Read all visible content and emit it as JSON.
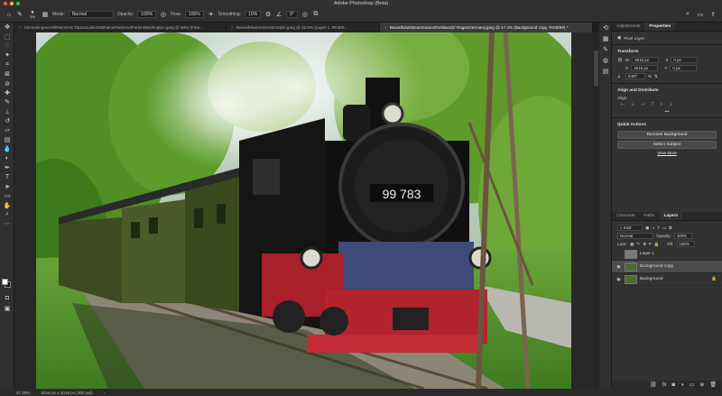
{
  "window": {
    "title": "Adobe Photoshop (Beta)"
  },
  "options": {
    "brush_size": "300",
    "mode_label": "Mode:",
    "mode_value": "Normal",
    "opacity_label": "Opacity:",
    "opacity_value": "100%",
    "flow_label": "Flow:",
    "flow_value": "100%",
    "smoothing_label": "Smoothing:",
    "smoothing_value": "10%",
    "angle_value": "0°"
  },
  "tabs": [
    {
      "label": "SunsettingoverMtRainierat TipsooLakeinMtRainierNationalParkinWashington.jpeg @ 50% (Fore...",
      "active": false
    },
    {
      "label": "Beautifulwomaninretrostyle.jpeg @ 32.8% (Layer 1, RGB/8...",
      "active": false
    },
    {
      "label": "Beautifuloldsteamtrainonthelslandof RügenGermany.jpeg @ 47.4% (Background copy, RGB/8#) *",
      "active": true
    }
  ],
  "photo": {
    "plate": "99 783"
  },
  "status": {
    "zoom": "47.38%",
    "doc_size": "6016 px x 4016 px (300 ppi)"
  },
  "properties": {
    "tabs": [
      "Adjustments",
      "Properties"
    ],
    "layer_type": "Pixel Layer",
    "transform_title": "Transform",
    "w_label": "W",
    "w_value": "6016 px",
    "h_label": "H",
    "h_value": "4016 px",
    "x_label": "X",
    "x_value": "0 px",
    "y_label": "Y",
    "y_value": "0 px",
    "angle": "0.00°",
    "align_title": "Align and Distribute",
    "align_label": "Align:",
    "quick_actions_title": "Quick Actions",
    "remove_bg": "Remove Background",
    "select_subject": "Select Subject",
    "view_more": "View More"
  },
  "layers_panel": {
    "tabs": [
      "Channels",
      "Paths",
      "Layers"
    ],
    "kind": "Kind",
    "blend": "Normal",
    "opacity_label": "Opacity:",
    "opacity_value": "100%",
    "lock_label": "Lock:",
    "fill_label": "Fill:",
    "fill_value": "100%",
    "layers": [
      {
        "name": "Layer 1",
        "visible": false,
        "selected": false
      },
      {
        "name": "Background copy",
        "visible": true,
        "selected": true
      },
      {
        "name": "Background",
        "visible": true,
        "selected": false,
        "locked": true
      }
    ]
  },
  "colors": {
    "foreground": "#ffffff",
    "background": "#111111",
    "panel": "#323232",
    "accent": "#1473e6"
  }
}
